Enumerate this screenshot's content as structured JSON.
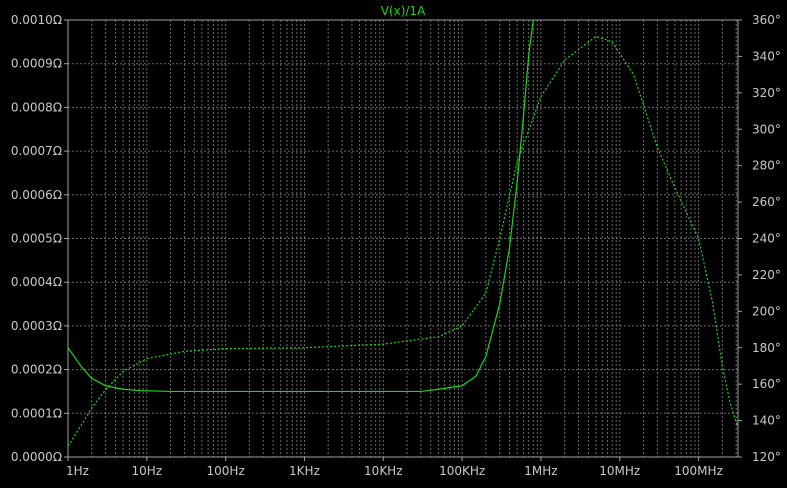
{
  "colors": {
    "background": "#000000",
    "axis": "#a0a0a0",
    "grid": "#6a6a6a",
    "tick_text": "#c8c8c8",
    "trace": "#18d818",
    "title": "#18d818"
  },
  "chart_data": {
    "type": "line",
    "title": "V(x)/1A",
    "xscale": "log",
    "xlim": [
      1,
      316227766
    ],
    "ylim_left": [
      0,
      0.001
    ],
    "ylim_right": [
      120,
      360
    ],
    "grid": true,
    "x_tick_labels": [
      "1Hz",
      "10Hz",
      "100Hz",
      "1KHz",
      "10KHz",
      "100KHz",
      "1MHz",
      "10MHz",
      "100MHz"
    ],
    "y_left_tick_labels": [
      "0.0000Ω",
      "0.0001Ω",
      "0.0002Ω",
      "0.0003Ω",
      "0.0004Ω",
      "0.0005Ω",
      "0.0006Ω",
      "0.0007Ω",
      "0.0008Ω",
      "0.0009Ω",
      "0.0010Ω"
    ],
    "y_right_tick_labels": [
      "120°",
      "140°",
      "160°",
      "180°",
      "200°",
      "220°",
      "240°",
      "260°",
      "280°",
      "300°",
      "320°",
      "340°",
      "360°"
    ],
    "series": [
      {
        "axis": "left",
        "style": "solid",
        "points": [
          [
            1,
            0.00025
          ],
          [
            1.5,
            0.000205
          ],
          [
            2,
            0.00018
          ],
          [
            3,
            0.000163
          ],
          [
            5,
            0.000155
          ],
          [
            8,
            0.000152
          ],
          [
            20,
            0.00015
          ],
          [
            1000,
            0.00015
          ],
          [
            30000,
            0.00015
          ],
          [
            50000,
            0.000155
          ],
          [
            100000,
            0.000163
          ],
          [
            150000,
            0.000185
          ],
          [
            200000,
            0.00023
          ],
          [
            300000,
            0.00035
          ],
          [
            400000,
            0.00048
          ],
          [
            500000,
            0.00063
          ],
          [
            600000,
            0.00078
          ],
          [
            700000,
            0.00092
          ],
          [
            800000,
            0.00101
          ]
        ]
      },
      {
        "axis": "right",
        "style": "dotted",
        "points": [
          [
            1,
            126
          ],
          [
            1.5,
            138
          ],
          [
            2,
            147
          ],
          [
            3,
            157
          ],
          [
            5,
            167
          ],
          [
            10,
            174
          ],
          [
            30,
            178
          ],
          [
            100,
            179.5
          ],
          [
            1000,
            180
          ],
          [
            10000,
            182
          ],
          [
            50000,
            186
          ],
          [
            100000,
            192
          ],
          [
            200000,
            210
          ],
          [
            300000,
            240
          ],
          [
            500000,
            282
          ],
          [
            1000000,
            318
          ],
          [
            2000000,
            338
          ],
          [
            5000000,
            351
          ],
          [
            8000000,
            348
          ],
          [
            15000000,
            330
          ],
          [
            30000000,
            290
          ],
          [
            50000000,
            268
          ],
          [
            100000000,
            240
          ],
          [
            150000000,
            205
          ],
          [
            200000000,
            170
          ],
          [
            250000000,
            150
          ],
          [
            316227766,
            136
          ]
        ]
      }
    ]
  }
}
